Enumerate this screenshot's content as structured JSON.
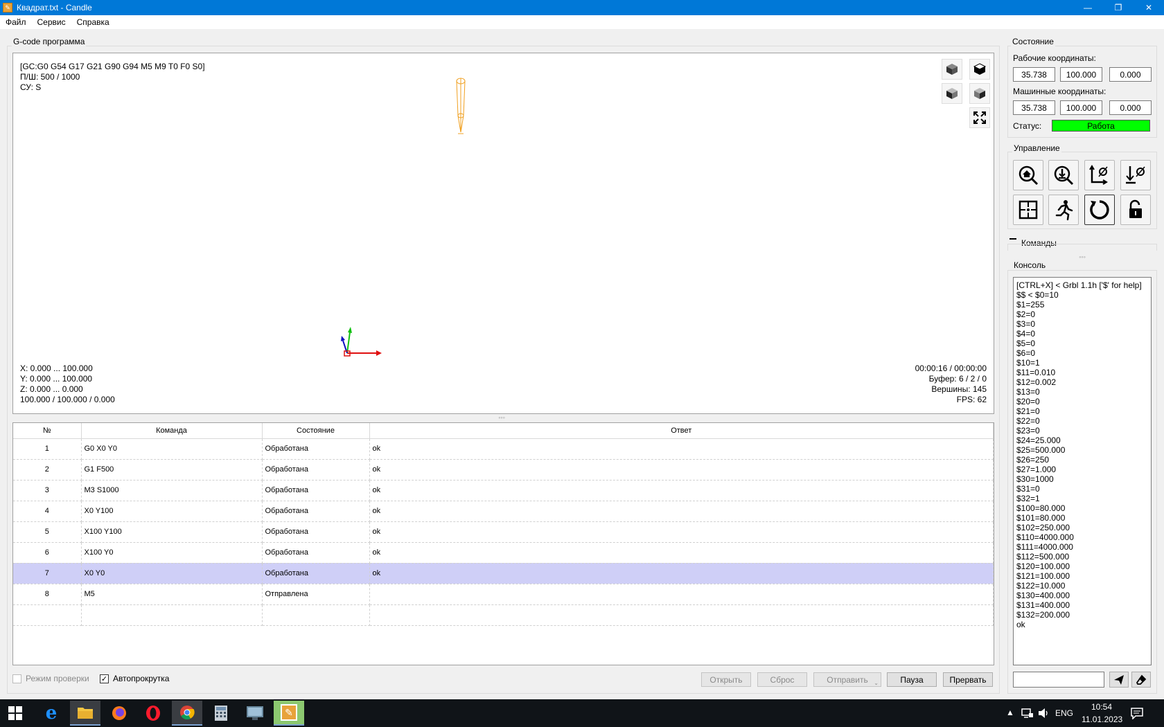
{
  "window": {
    "title": "Квадрат.txt - Candle"
  },
  "menu": [
    "Файл",
    "Сервис",
    "Справка"
  ],
  "program": {
    "group_title": "G-code программа",
    "overlay_top": [
      "[GC:G0 G54 G17 G21 G90 G94 M5 M9 T0 F0 S0]",
      "П/Ш: 500 / 1000",
      "СУ: S"
    ],
    "overlay_bottom_left": [
      "X: 0.000 ... 100.000",
      "Y: 0.000 ... 100.000",
      "Z: 0.000 ... 0.000",
      "100.000 / 100.000 / 0.000"
    ],
    "overlay_bottom_right": [
      "00:00:16 / 00:00:00",
      "Буфер: 6 / 2 / 0",
      "Вершины: 145",
      "FPS: 62"
    ]
  },
  "table": {
    "headers": [
      "№",
      "Команда",
      "Состояние",
      "Ответ"
    ],
    "rows": [
      {
        "num": "1",
        "cmd": "G0 X0 Y0",
        "state": "Обработана",
        "resp": "ok"
      },
      {
        "num": "2",
        "cmd": "G1 F500",
        "state": "Обработана",
        "resp": "ok"
      },
      {
        "num": "3",
        "cmd": "M3 S1000",
        "state": "Обработана",
        "resp": "ok"
      },
      {
        "num": "4",
        "cmd": "X0 Y100",
        "state": "Обработана",
        "resp": "ok"
      },
      {
        "num": "5",
        "cmd": "X100 Y100",
        "state": "Обработана",
        "resp": "ok"
      },
      {
        "num": "6",
        "cmd": "X100 Y0",
        "state": "Обработана",
        "resp": "ok"
      },
      {
        "num": "7",
        "cmd": "X0 Y0",
        "state": "Обработана",
        "resp": "ok"
      },
      {
        "num": "8",
        "cmd": "M5",
        "state": "Отправлена",
        "resp": ""
      },
      {
        "num": "",
        "cmd": "",
        "state": "",
        "resp": ""
      }
    ],
    "selected_row": 7
  },
  "bottom": {
    "check_mode": "Режим проверки",
    "autoscroll": "Автопрокрутка",
    "open": "Открыть",
    "reset": "Сброс",
    "send": "Отправить",
    "pause": "Пауза",
    "abort": "Прервать"
  },
  "state": {
    "title": "Состояние",
    "work_label": "Рабочие координаты:",
    "work": [
      "35.738",
      "100.000",
      "0.000"
    ],
    "machine_label": "Машинные координаты:",
    "machine": [
      "35.738",
      "100.000",
      "0.000"
    ],
    "status_label": "Статус:",
    "status_value": "Работа",
    "status_color": "#00ff00"
  },
  "control": {
    "title": "Управление",
    "buttons": [
      "home-search-icon",
      "probe-icon",
      "zero-xy-icon",
      "zero-z-icon",
      "restore-origin-icon",
      "safe-position-icon",
      "soft-reset-icon",
      "unlock-icon"
    ]
  },
  "commands_title": "Команды",
  "console": {
    "title": "Консоль",
    "lines": [
      "[CTRL+X] < Grbl 1.1h ['$' for help]",
      "$$ < $0=10",
      "$1=255",
      "$2=0",
      "$3=0",
      "$4=0",
      "$5=0",
      "$6=0",
      "$10=1",
      "$11=0.010",
      "$12=0.002",
      "$13=0",
      "$20=0",
      "$21=0",
      "$22=0",
      "$23=0",
      "$24=25.000",
      "$25=500.000",
      "$26=250",
      "$27=1.000",
      "$30=1000",
      "$31=0",
      "$32=1",
      "$100=80.000",
      "$101=80.000",
      "$102=250.000",
      "$110=4000.000",
      "$111=4000.000",
      "$112=500.000",
      "$120=100.000",
      "$121=100.000",
      "$122=10.000",
      "$130=400.000",
      "$131=400.000",
      "$132=200.000",
      "ok"
    ],
    "input_value": ""
  },
  "taskbar": {
    "lang": "ENG",
    "time": "10:54",
    "date": "11.01.2023"
  }
}
